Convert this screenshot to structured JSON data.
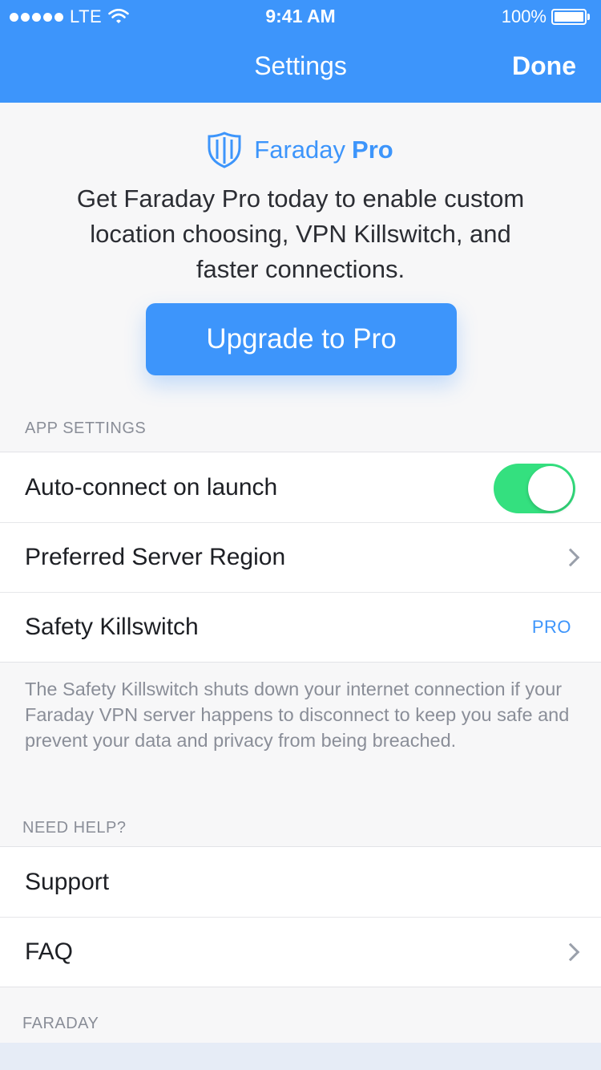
{
  "status_bar": {
    "carrier": "LTE",
    "time": "9:41 AM",
    "battery": "100%"
  },
  "nav": {
    "title": "Settings",
    "done_label": "Done"
  },
  "promo": {
    "brand_name": "Faraday",
    "brand_tier": "Pro",
    "description": "Get Faraday Pro today to enable custom location choosing, VPN Killswitch, and faster connections.",
    "upgrade_label": "Upgrade to Pro"
  },
  "app_settings": {
    "header": "APP SETTINGS",
    "auto_connect": {
      "label": "Auto-connect on launch",
      "enabled": true
    },
    "server_region": {
      "label": "Preferred Server Region"
    },
    "killswitch": {
      "label": "Safety Killswitch",
      "tag": "PRO"
    },
    "footnote": "The Safety Killswitch shuts down your internet connection if your Faraday VPN server happens to disconnect to keep you safe and prevent your data and privacy from being breached."
  },
  "help": {
    "header": "NEED HELP?",
    "support": {
      "label": "Support"
    },
    "faq": {
      "label": "FAQ"
    }
  },
  "faraday_section": {
    "header": "FARADAY"
  },
  "colors": {
    "accent": "#3d95fb",
    "toggle_on": "#34e07f",
    "muted_text": "#8a8e98",
    "background": "#f7f7f8"
  },
  "icons": [
    "signal-dots-icon",
    "wifi-icon",
    "battery-icon",
    "shield-icon",
    "chevron-right-icon"
  ]
}
